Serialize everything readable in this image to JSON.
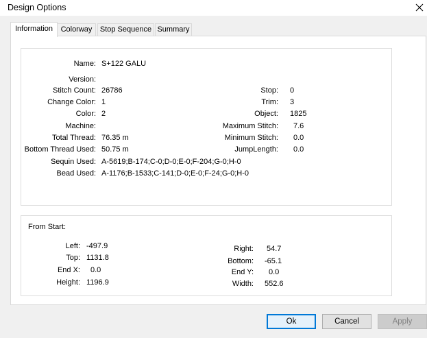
{
  "window": {
    "title": "Design Options"
  },
  "tabs": [
    {
      "label": "Information",
      "active": true
    },
    {
      "label": "Colorway",
      "active": false
    },
    {
      "label": "Stop Sequence",
      "active": false
    },
    {
      "label": "Summary",
      "active": false
    }
  ],
  "info": {
    "name_label": "Name:",
    "name_value": "S+122 GALU",
    "version_label": "Version:",
    "version_value": "",
    "stitch_count_label": "Stitch Count:",
    "stitch_count_value": "26786",
    "change_color_label": "Change Color:",
    "change_color_value": "1",
    "color_label": "Color:",
    "color_value": "2",
    "machine_label": "Machine:",
    "machine_value": "",
    "total_thread_label": "Total Thread:",
    "total_thread_value": "76.35 m",
    "bottom_thread_label": "Bottom Thread Used:",
    "bottom_thread_value": "50.75 m",
    "sequin_label": "Sequin Used:",
    "sequin_value": "A-5619;B-174;C-0;D-0;E-0;F-204;G-0;H-0",
    "bead_label": "Bead Used:",
    "bead_value": "A-1176;B-1533;C-141;D-0;E-0;F-24;G-0;H-0",
    "stop_label": "Stop:",
    "stop_value": "0",
    "trim_label": "Trim:",
    "trim_value": "3",
    "object_label": "Object:",
    "object_value": "1825",
    "max_stitch_label": "Maximum Stitch:",
    "max_stitch_value": "7.6",
    "min_stitch_label": "Minimum Stitch:",
    "min_stitch_value": "0.0",
    "jump_length_label": "JumpLength:",
    "jump_length_value": "0.0"
  },
  "from_start": {
    "heading": "From Start:",
    "left_label": "Left:",
    "left_value": "-497.9",
    "top_label": "Top:",
    "top_value": "1131.8",
    "endx_label": "End X:",
    "endx_value": "0.0",
    "height_label": "Height:",
    "height_value": "1196.9",
    "right_label": "Right:",
    "right_value": "54.7",
    "bottom_label": "Bottom:",
    "bottom_value": "-65.1",
    "endy_label": "End Y:",
    "endy_value": "0.0",
    "width_label": "Width:",
    "width_value": "552.6"
  },
  "buttons": {
    "ok": "Ok",
    "cancel": "Cancel",
    "apply": "Apply"
  }
}
